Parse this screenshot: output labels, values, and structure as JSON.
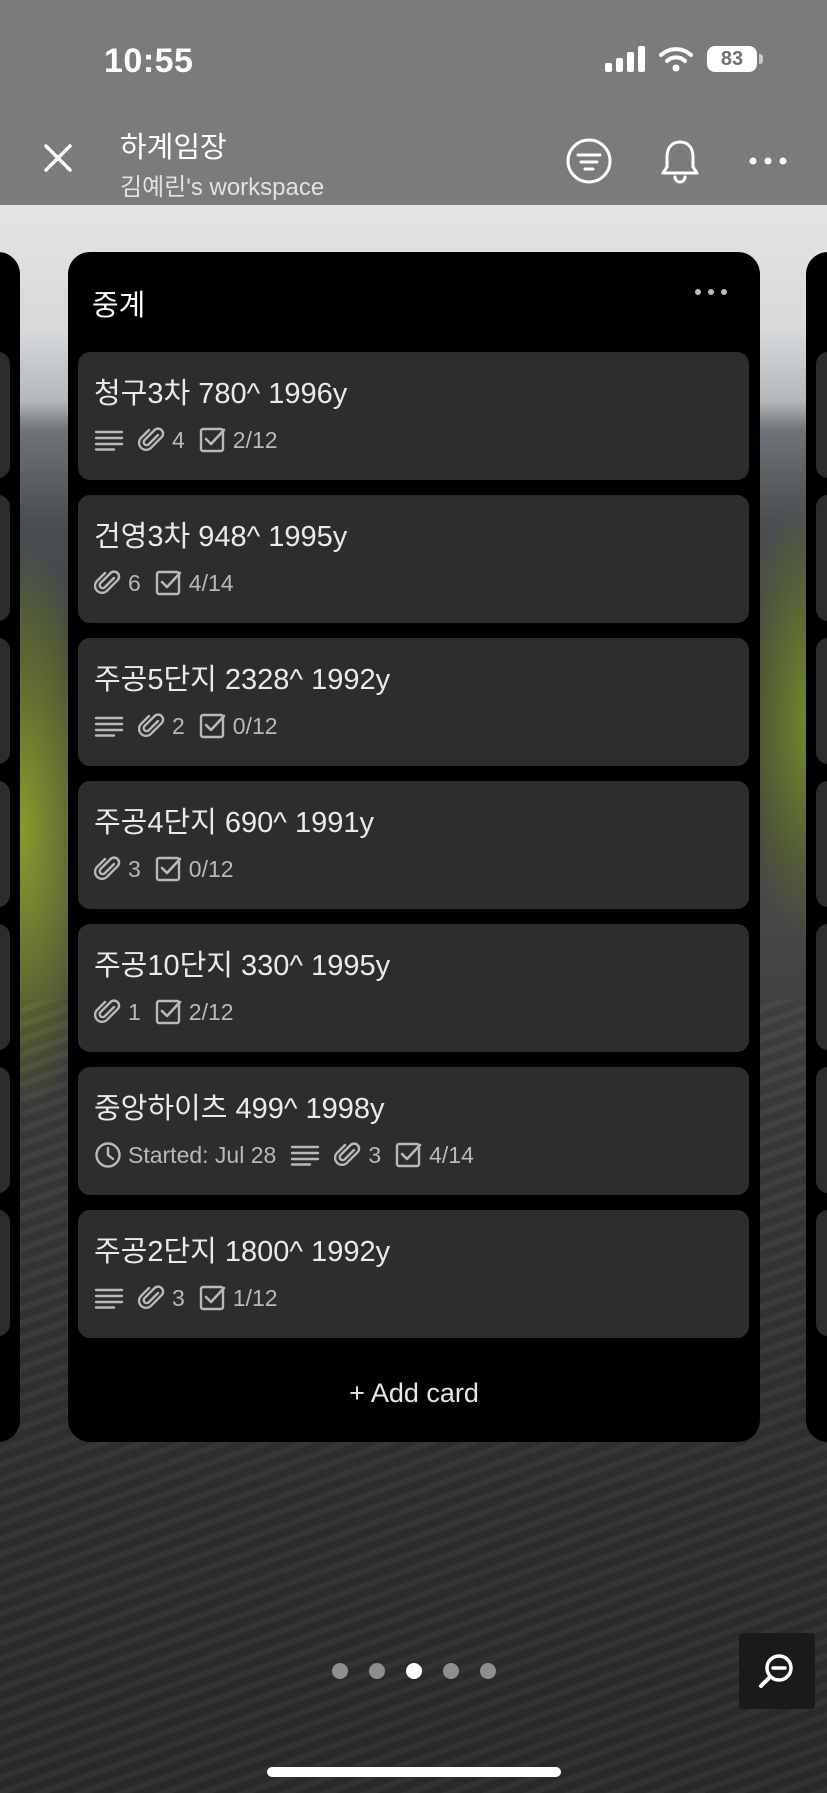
{
  "status_bar": {
    "time": "10:55",
    "battery": "83"
  },
  "header": {
    "title": "하계임장",
    "subtitle": "김예린's workspace",
    "close_icon": "close-icon",
    "filter_icon": "filter-icon",
    "notifications_icon": "bell-icon",
    "more_icon": "more-icon"
  },
  "list": {
    "title": "중계",
    "add_card_label": "+ Add card",
    "cards": [
      {
        "title": "청구3차 780^ 1996y",
        "has_description": true,
        "attachments": "4",
        "checklist": "2/12",
        "started": ""
      },
      {
        "title": "건영3차 948^ 1995y",
        "has_description": false,
        "attachments": "6",
        "checklist": "4/14",
        "started": ""
      },
      {
        "title": "주공5단지 2328^ 1992y",
        "has_description": true,
        "attachments": "2",
        "checklist": "0/12",
        "started": ""
      },
      {
        "title": "주공4단지 690^ 1991y",
        "has_description": false,
        "attachments": "3",
        "checklist": "0/12",
        "started": ""
      },
      {
        "title": "주공10단지 330^ 1995y",
        "has_description": false,
        "attachments": "1",
        "checklist": "2/12",
        "started": ""
      },
      {
        "title": "중앙하이츠 499^ 1998y",
        "has_description": true,
        "attachments": "3",
        "checklist": "4/14",
        "started": "Started: Jul 28"
      },
      {
        "title": "주공2단지 1800^ 1992y",
        "has_description": true,
        "attachments": "3",
        "checklist": "1/12",
        "started": ""
      }
    ]
  },
  "pager": {
    "count": 5,
    "active_index": 2
  },
  "zoom_icon": "zoom-out-icon"
}
